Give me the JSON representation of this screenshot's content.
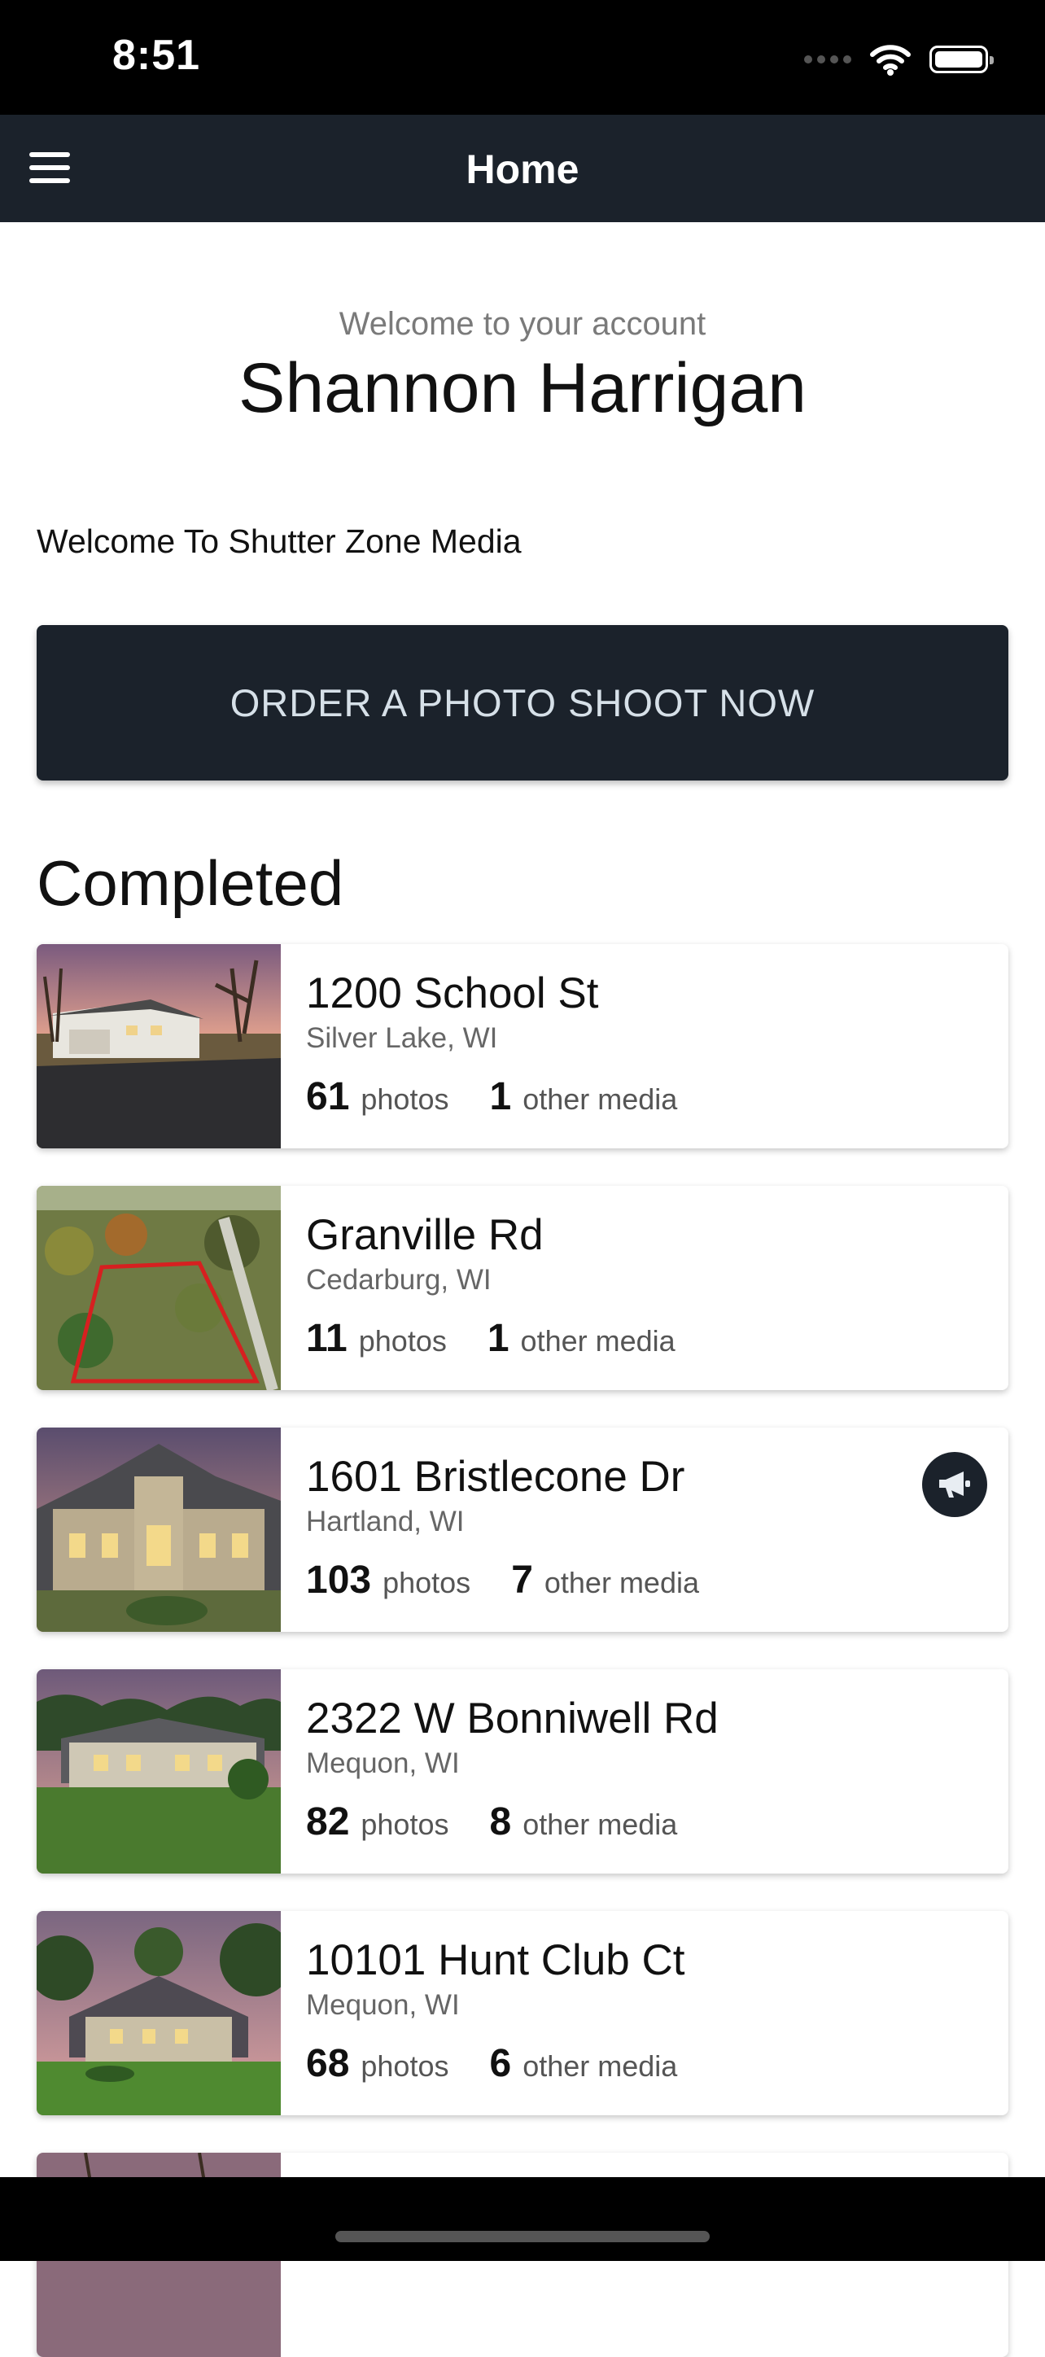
{
  "status_bar": {
    "time": "8:51"
  },
  "nav": {
    "title": "Home"
  },
  "account": {
    "welcome_label": "Welcome to your account",
    "name": "Shannon Harrigan",
    "company_welcome": "Welcome To Shutter Zone Media"
  },
  "order_button": {
    "label": "ORDER A PHOTO SHOOT NOW"
  },
  "completed": {
    "title": "Completed",
    "labels": {
      "photos": "photos",
      "other_media": "other media"
    },
    "items": [
      {
        "address": "1200 School St",
        "city": "Silver Lake, WI",
        "photos": "61",
        "other_media": "1"
      },
      {
        "address": "Granville Rd",
        "city": "Cedarburg, WI",
        "photos": "11",
        "other_media": "1"
      },
      {
        "address": "1601 Bristlecone Dr",
        "city": "Hartland, WI",
        "photos": "103",
        "other_media": "7",
        "promo_icon": "megaphone-icon"
      },
      {
        "address": "2322 W Bonniwell Rd",
        "city": "Mequon, WI",
        "photos": "82",
        "other_media": "8"
      },
      {
        "address": "10101 Hunt Club Ct",
        "city": "Mequon, WI",
        "photos": "68",
        "other_media": "6"
      }
    ]
  },
  "colors": {
    "nav_bg": "#1b222b",
    "button_text": "#d6e0e8"
  }
}
